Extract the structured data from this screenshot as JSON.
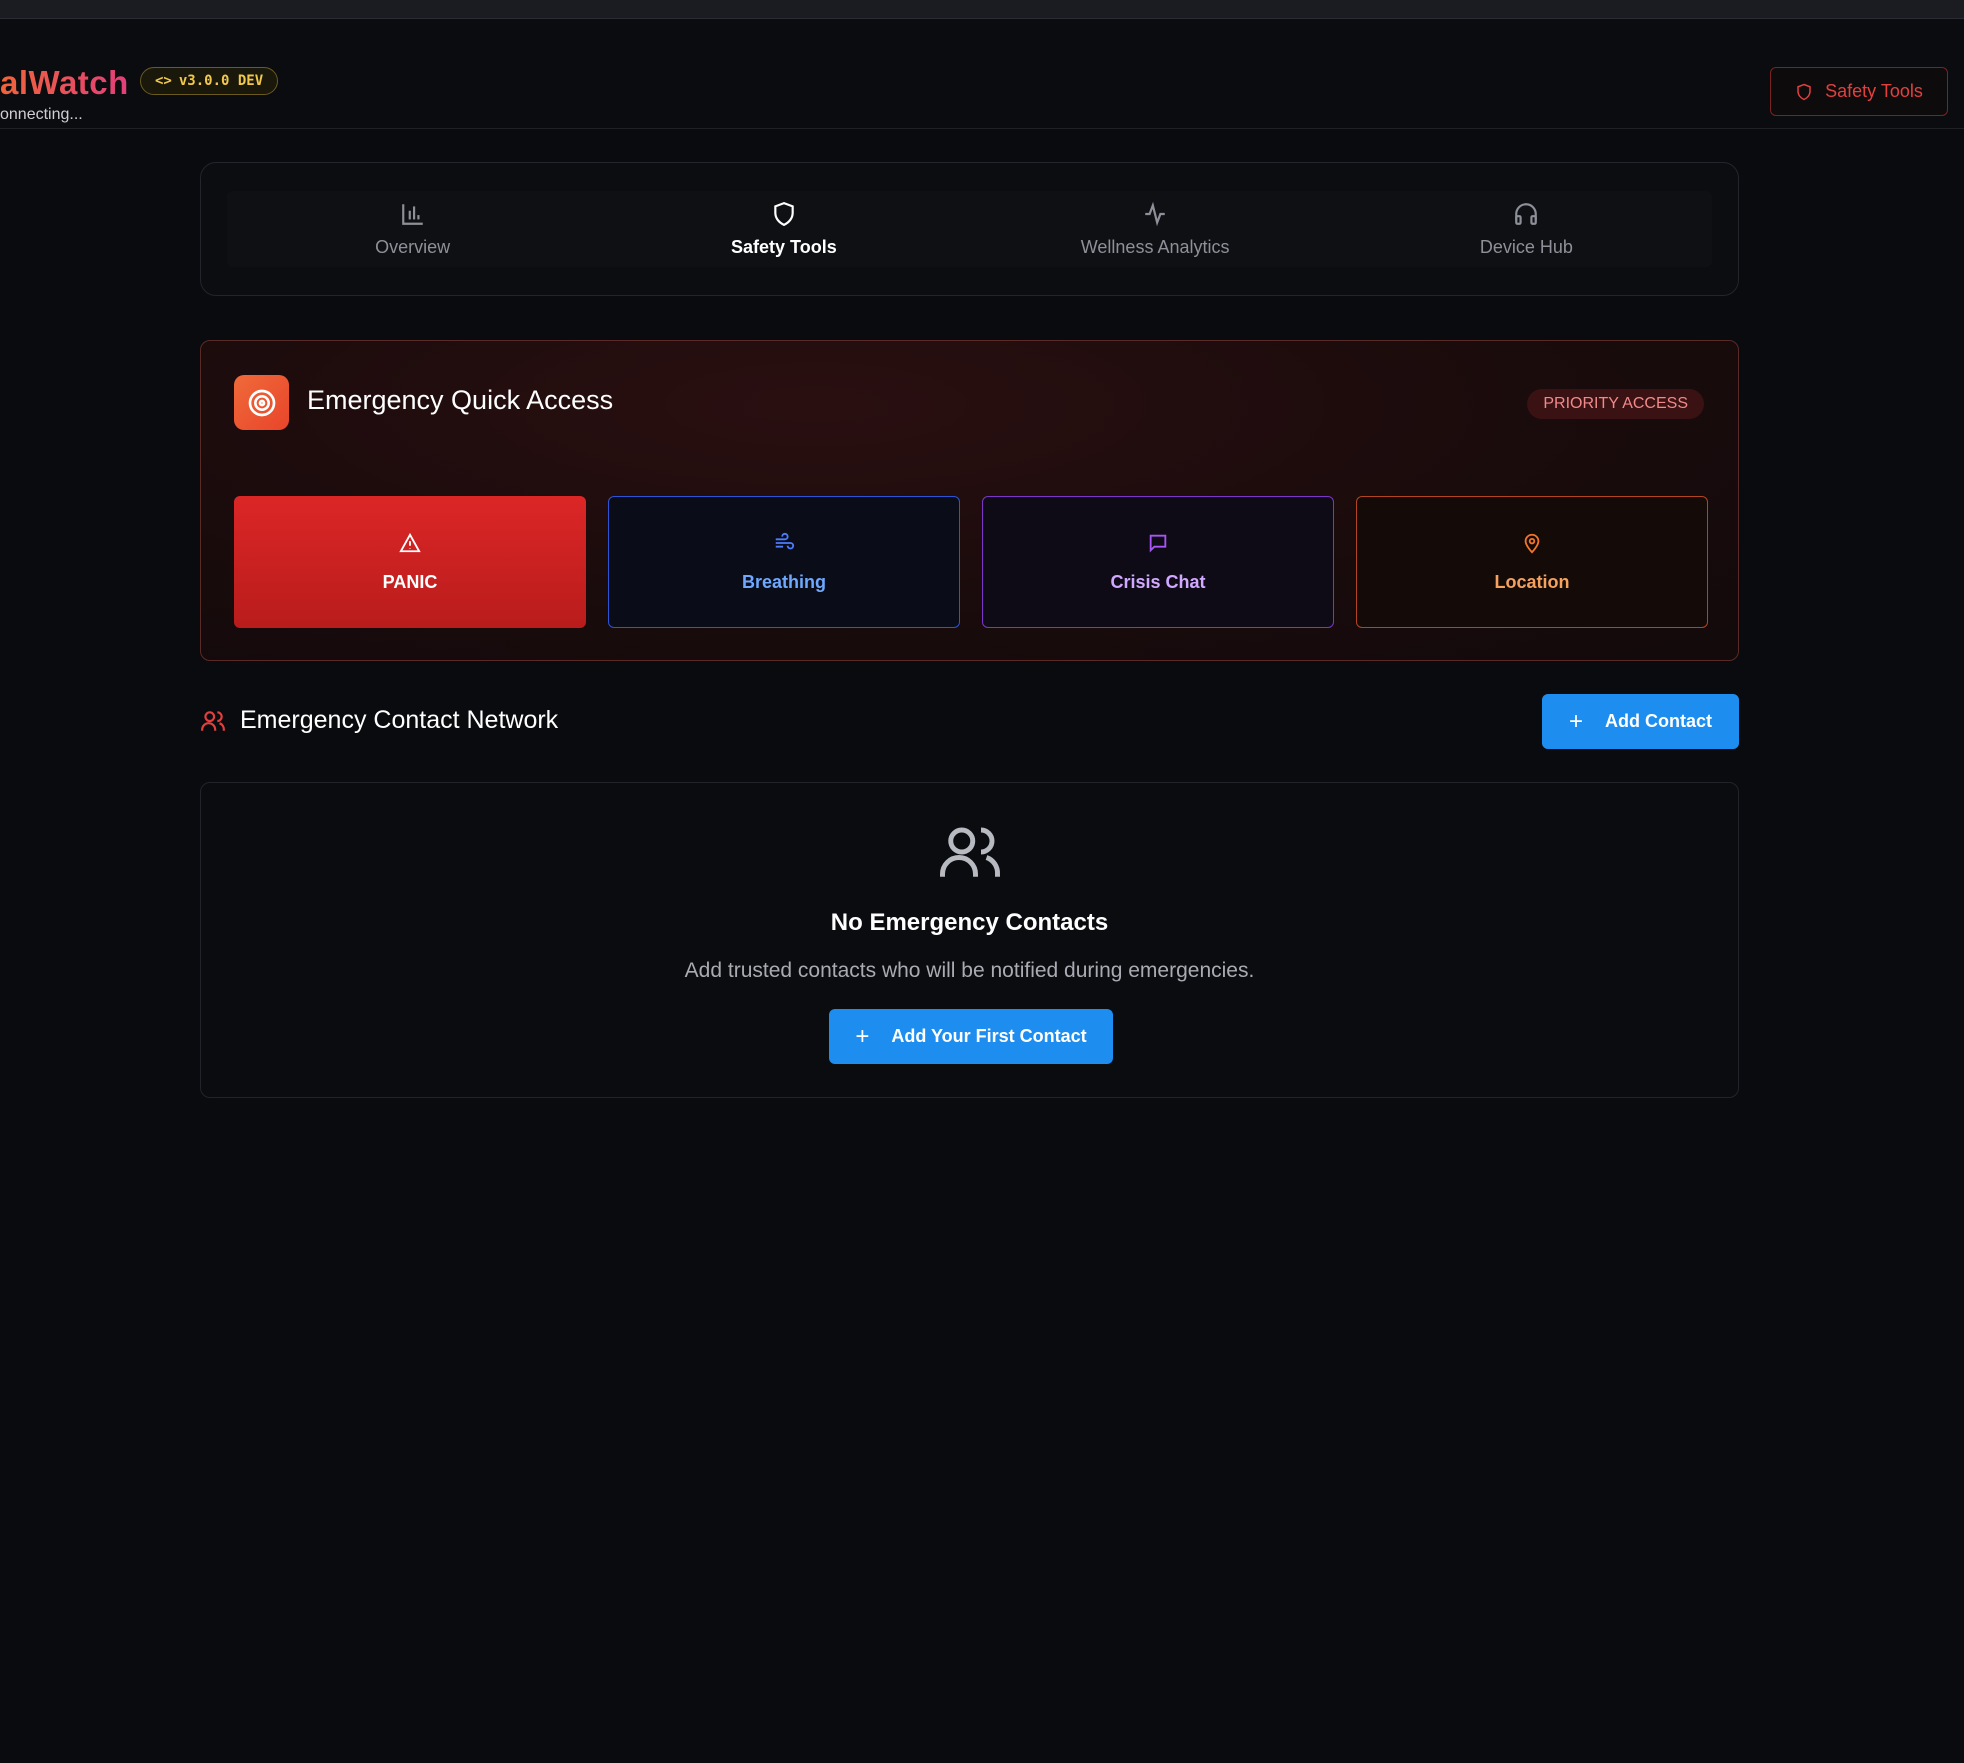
{
  "header": {
    "brand": "alWatch",
    "status": "onnecting...",
    "version": "v3.0.0 DEV",
    "safety_button": "Safety Tools"
  },
  "nav": {
    "tabs": [
      {
        "label": "Overview",
        "icon": "bar-chart-icon"
      },
      {
        "label": "Safety Tools",
        "icon": "shield-icon",
        "active": true
      },
      {
        "label": "Wellness Analytics",
        "icon": "activity-icon"
      },
      {
        "label": "Device Hub",
        "icon": "headphones-icon"
      }
    ]
  },
  "quick_access": {
    "title": "Emergency Quick Access",
    "badge": "PRIORITY ACCESS",
    "buttons": [
      {
        "label": "PANIC",
        "icon": "warning-triangle-icon"
      },
      {
        "label": "Breathing",
        "icon": "wind-icon"
      },
      {
        "label": "Crisis Chat",
        "icon": "message-square-icon"
      },
      {
        "label": "Location",
        "icon": "map-pin-icon"
      }
    ]
  },
  "contacts": {
    "title": "Emergency Contact Network",
    "add_button": "Add Contact",
    "empty_title": "No Emergency Contacts",
    "empty_sub": "Add trusted contacts who will be notified during emergencies.",
    "add_first_button": "Add Your First Contact"
  },
  "colors": {
    "accent_blue": "#1e8df0",
    "panic_red": "#dc2626",
    "brand_gradient_start": "#f0643a",
    "brand_gradient_end": "#e23f7a"
  }
}
